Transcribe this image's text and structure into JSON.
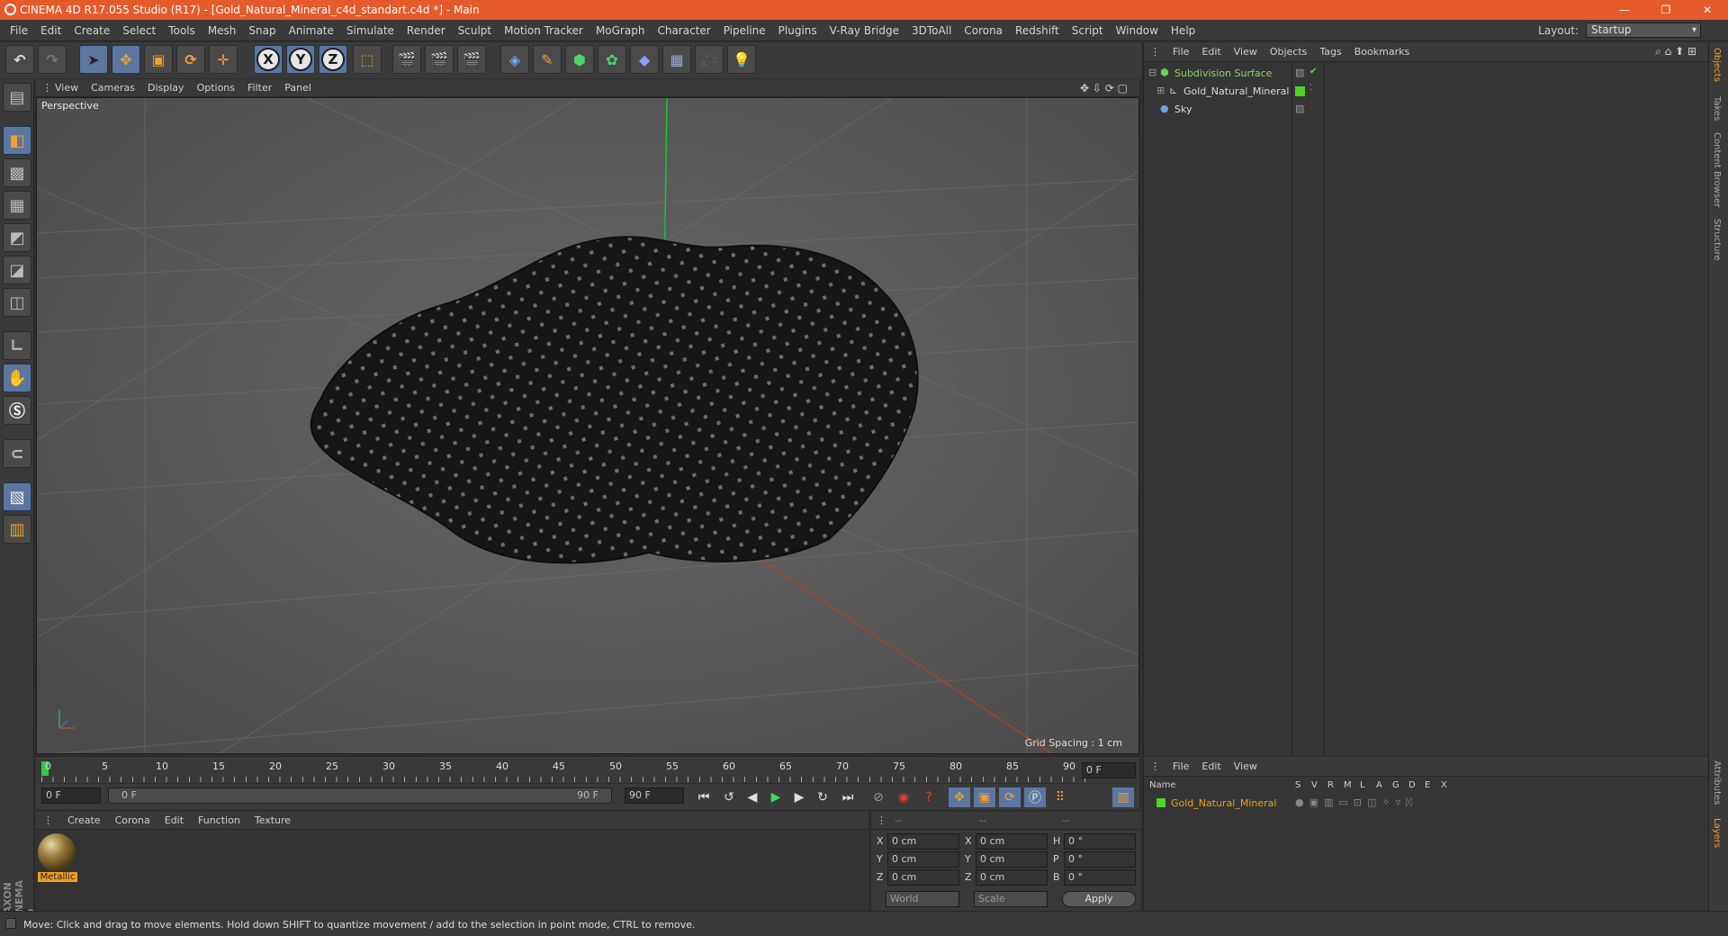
{
  "title": "CINEMA 4D R17.055 Studio (R17) - [Gold_Natural_Mineral_c4d_standart.c4d *] - Main",
  "window_controls": [
    "—",
    "❐",
    "✕"
  ],
  "menu": [
    "File",
    "Edit",
    "Create",
    "Select",
    "Tools",
    "Mesh",
    "Snap",
    "Animate",
    "Simulate",
    "Render",
    "Sculpt",
    "Motion Tracker",
    "MoGraph",
    "Character",
    "Pipeline",
    "Plugins",
    "V-Ray Bridge",
    "3DToAll",
    "Corona",
    "Redshift",
    "Script",
    "Window",
    "Help"
  ],
  "layout": {
    "label": "Layout:",
    "value": "Startup"
  },
  "toolbar_axes": [
    "X",
    "Y",
    "Z"
  ],
  "viewport": {
    "menu": [
      "View",
      "Cameras",
      "Display",
      "Options",
      "Filter",
      "Panel"
    ],
    "label": "Perspective",
    "grid_spacing": "Grid Spacing : 1 cm"
  },
  "timeline": {
    "ticks": [
      "0",
      "5",
      "10",
      "15",
      "20",
      "25",
      "30",
      "35",
      "40",
      "45",
      "50",
      "55",
      "60",
      "65",
      "70",
      "75",
      "80",
      "85",
      "90"
    ],
    "current": "0 F",
    "start": "0 F",
    "slider_start": "0 F",
    "slider_end": "90 F",
    "end": "90 F"
  },
  "materials": {
    "menu": [
      "Create",
      "Corona",
      "Edit",
      "Function",
      "Texture"
    ],
    "items": [
      {
        "name": "Metallic"
      }
    ]
  },
  "coords": {
    "header": [
      "--",
      "--",
      "--"
    ],
    "rows": [
      [
        "X",
        "0 cm",
        "X",
        "0 cm",
        "H",
        "0 °"
      ],
      [
        "Y",
        "0 cm",
        "Y",
        "0 cm",
        "P",
        "0 °"
      ],
      [
        "Z",
        "0 cm",
        "Z",
        "0 cm",
        "B",
        "0 °"
      ]
    ],
    "world": "World",
    "scale": "Scale",
    "apply": "Apply"
  },
  "objects": {
    "menu": [
      "File",
      "Edit",
      "View",
      "Objects",
      "Tags",
      "Bookmarks"
    ],
    "items": [
      {
        "name": "Subdivision Surface",
        "color": "#8fd46a"
      },
      {
        "name": "Gold_Natural_Mineral",
        "color": "#dcdcdc"
      },
      {
        "name": "Sky",
        "color": "#dcdcdc"
      }
    ]
  },
  "attributes": {
    "menu": [
      "File",
      "Edit",
      "View"
    ],
    "columns": [
      "Name",
      "S",
      "V",
      "R",
      "M",
      "L",
      "A",
      "G",
      "D",
      "E",
      "X"
    ],
    "row": "Gold_Natural_Mineral"
  },
  "right_tabs": [
    "Objects",
    "Takes",
    "Content Browser",
    "Structure",
    "Attributes",
    "Layers"
  ],
  "status": "Move: Click and drag to move elements. Hold down SHIFT to quantize movement / add to the selection in point mode, CTRL to remove.",
  "brand": "MAXON CINEMA 4D"
}
